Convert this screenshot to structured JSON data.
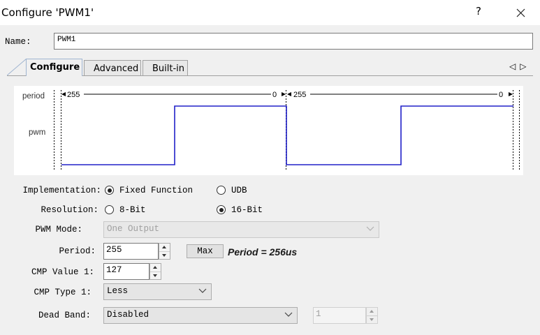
{
  "window": {
    "title": "Configure 'PWM1'",
    "help_glyph": "?",
    "close_icon": "close-icon"
  },
  "name": {
    "label": "Name:",
    "value": "PWM1"
  },
  "tabs": [
    {
      "label": "Configure",
      "active": true
    },
    {
      "label": "Advanced",
      "active": false
    },
    {
      "label": "Built-in",
      "active": false
    }
  ],
  "tab_scroll": {
    "left": "◁",
    "right": "▷"
  },
  "waveform": {
    "signal_labels": [
      "period",
      "pwm"
    ],
    "period_marks": [
      "255",
      "0",
      "255",
      "0"
    ],
    "line_color": "#2020c8"
  },
  "form": {
    "implementation": {
      "label": "Implementation:",
      "options": [
        "Fixed Function",
        "UDB"
      ],
      "selected": "Fixed Function"
    },
    "resolution": {
      "label": "Resolution:",
      "options": [
        "8-Bit",
        "16-Bit"
      ],
      "selected": "16-Bit"
    },
    "pwm_mode": {
      "label": "PWM Mode:",
      "value": "One Output",
      "enabled": false
    },
    "period": {
      "label": "Period:",
      "value": "255",
      "max_button": "Max",
      "readout": "Period = 256us"
    },
    "cmp_value_1": {
      "label": "CMP Value 1:",
      "value": "127"
    },
    "cmp_type_1": {
      "label": "CMP Type 1:",
      "value": "Less"
    },
    "dead_band": {
      "label": "Dead Band:",
      "value": "Disabled",
      "spin_value": "1",
      "spin_enabled": false
    }
  }
}
